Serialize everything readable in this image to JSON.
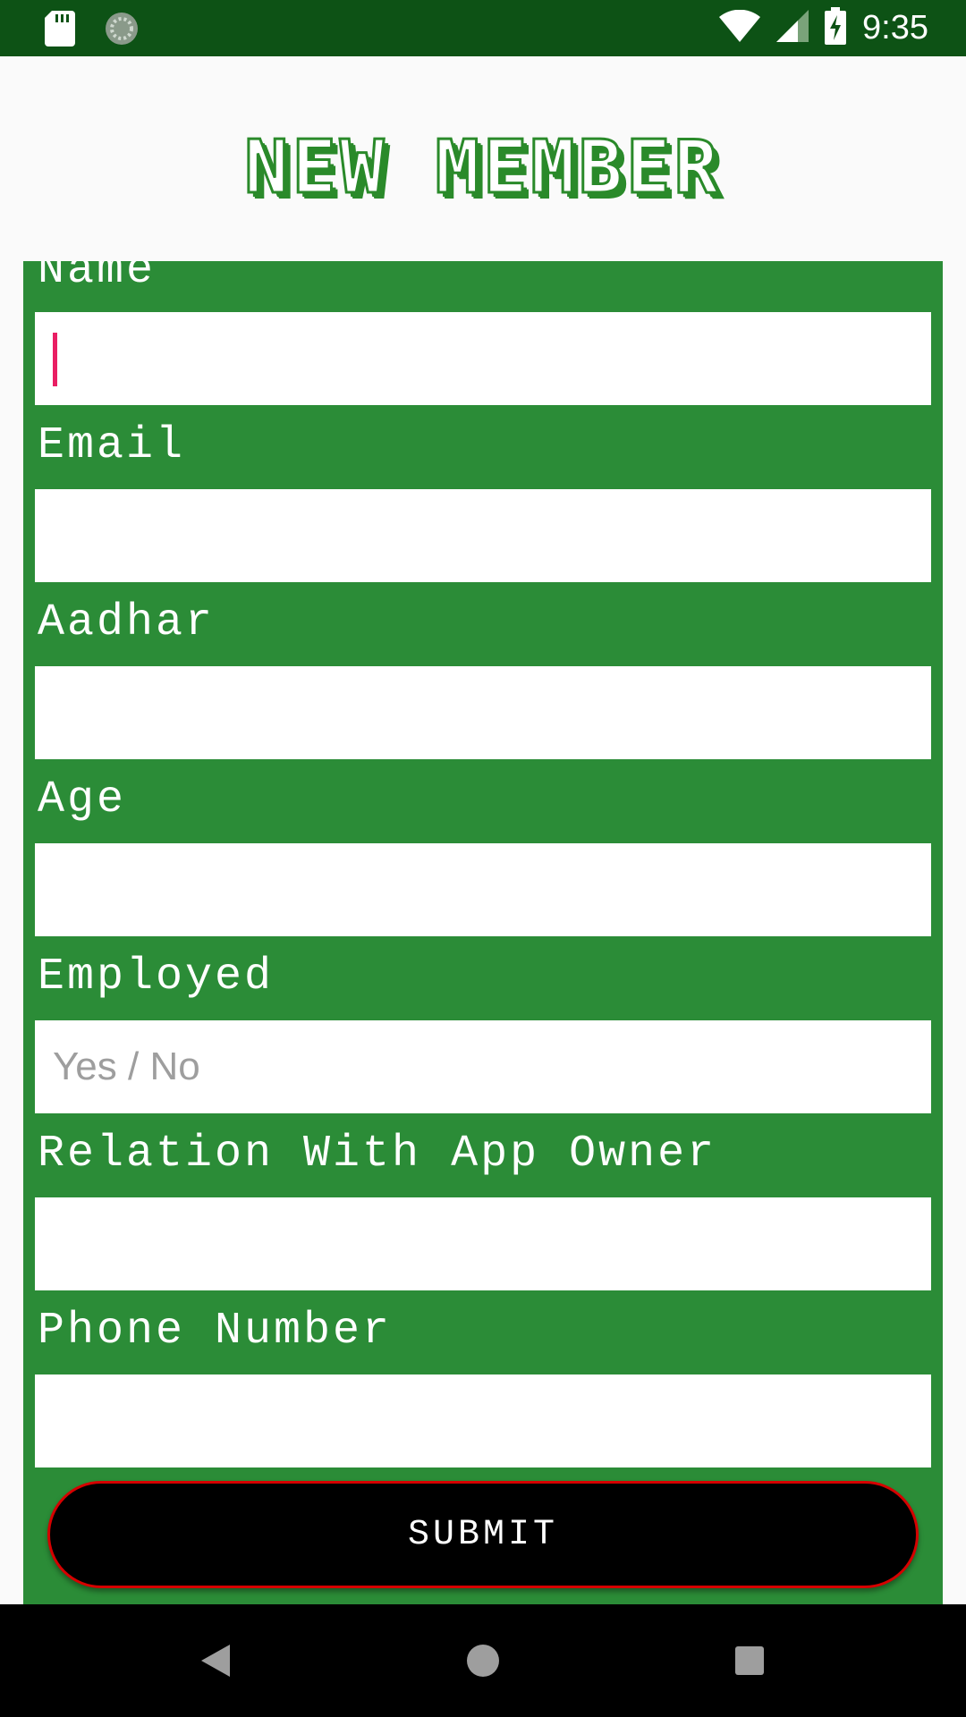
{
  "status_bar": {
    "time": "9:35",
    "icons": [
      "sd-card-icon",
      "sync-icon",
      "wifi-icon",
      "cell-signal-icon",
      "battery-charging-icon"
    ]
  },
  "header": {
    "title": "NEW MEMBER"
  },
  "form": {
    "fields": [
      {
        "label": "Name",
        "value": "",
        "placeholder": ""
      },
      {
        "label": "Email",
        "value": "",
        "placeholder": ""
      },
      {
        "label": "Aadhar",
        "value": "",
        "placeholder": ""
      },
      {
        "label": "Age",
        "value": "",
        "placeholder": ""
      },
      {
        "label": "Employed",
        "value": "",
        "placeholder": "Yes / No"
      },
      {
        "label": "Relation With App Owner",
        "value": "",
        "placeholder": ""
      },
      {
        "label": "Phone Number",
        "value": "",
        "placeholder": ""
      }
    ],
    "submit_label": "SUBMIT"
  },
  "nav_bar": {
    "icons": [
      "back-icon",
      "home-icon",
      "recents-icon"
    ]
  },
  "colors": {
    "status_bar": "#0d5215",
    "panel": "#2b8c37",
    "accent_cursor": "#e91e63",
    "button_border": "#d50000"
  }
}
